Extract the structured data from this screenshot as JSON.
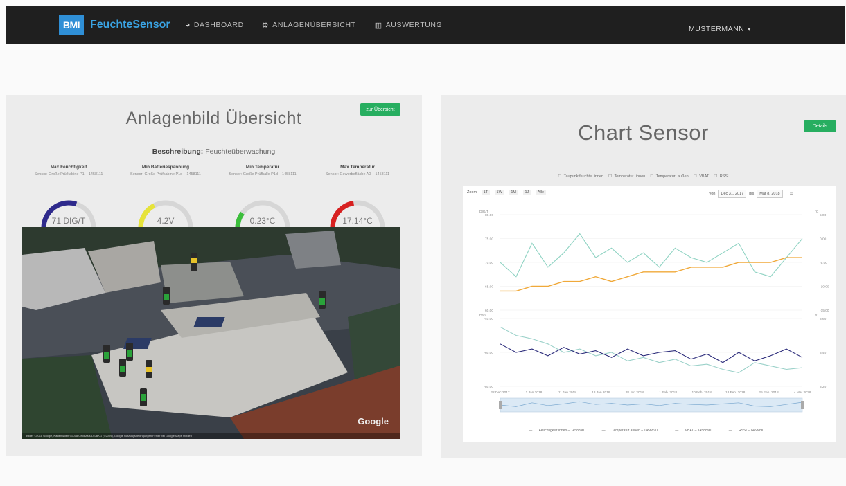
{
  "navbar": {
    "logo_text": "BMI",
    "brand": "FeuchteSensor",
    "links": [
      {
        "label": "DASHBOARD",
        "icon": "dashboard-icon"
      },
      {
        "label": "ANLAGENÜBERSICHT",
        "icon": "gear-icon"
      },
      {
        "label": "AUSWERTUNG",
        "icon": "chart-icon"
      }
    ],
    "user": "MUSTERMANN",
    "colors": {
      "bg": "#1f1f1f",
      "brand": "#3aa3e3",
      "logo_bg": "#2f8fd6"
    }
  },
  "left_panel": {
    "title": "Anlagenbild Übersicht",
    "button": "zur Übersicht",
    "description_label": "Beschreibung:",
    "description_value": "Feuchteüberwachung",
    "gauges": [
      {
        "title": "Max Feuchtigkeit",
        "sub": "Sensor: Große Prüfkabine P1 – 1458111",
        "value": "71 DIG/T",
        "fraction": 0.6,
        "color": "#2e2a8c"
      },
      {
        "title": "Min Batteriespannung",
        "sub": "Sensor: Große Prüfkabine P1d – 1458111",
        "value": "4.2V",
        "fraction": 0.35,
        "color": "#e6e33a"
      },
      {
        "title": "Min Temperatur",
        "sub": "Sensor: Große Prüfhalle P1d – 1458111",
        "value": "0.23°C",
        "fraction": 0.2,
        "color": "#3cbe3c"
      },
      {
        "title": "Max Temperatur",
        "sub": "Sensor: Gewerbefläche A0 – 1458111",
        "value": "17.14°C",
        "fraction": 0.45,
        "color": "#d72020"
      }
    ],
    "photo_credit": "Google",
    "photo_footer": "Bilder ©2018 Google, Kartendaten ©2018 GeoBasis-DE/BKG (©2009), Google   Nutzungsbedingungen   Fehler bei Google Maps melden"
  },
  "right_panel": {
    "title": "Chart Sensor",
    "button": "Details",
    "series_toggles": [
      "Taupunktfeuchte innen",
      "Temperatur innen",
      "Temperatur außen",
      "VBAT",
      "RSSI"
    ],
    "zoom_label": "Zoom",
    "zoom_options": [
      "1T",
      "1W",
      "1M",
      "1J",
      "Alle"
    ],
    "date_from_label": "Von",
    "date_from": "Dec 31, 2017",
    "date_to_label": "bis",
    "date_to": "Mar 8, 2018",
    "x_labels": [
      "22.Dec 2017",
      "1.Jan 2018",
      "11.Jan 2018",
      "18.Jan 2018",
      "28.Jan 2018",
      "1.Feb. 2018",
      "10.Feb. 2018",
      "18.Feb. 2018",
      "25.Feb. 2018",
      "4.Mar 2018"
    ],
    "upper_left_ticks": [
      "80.00",
      "75.00",
      "70.00",
      "65.00",
      "60.00"
    ],
    "upper_right_ticks": [
      "5.00",
      "0.00",
      "-5.00",
      "-10.00",
      "-15.00"
    ],
    "upper_left_unit": "DIG/T",
    "upper_right_unit": "°C",
    "lower_left_ticks": [
      "-40.00",
      "-60.00",
      "-80.00"
    ],
    "lower_right_ticks": [
      "3.60",
      "3.40",
      "3.20"
    ],
    "lower_left_unit": "Dbm",
    "lower_right_unit": "V",
    "bottom_legend": [
      "Feuchtigkeit innen – 1458890",
      "Temperatur außen – 1458890",
      "VBAT – 1458890",
      "RSSI – 1458890"
    ],
    "series_colors": {
      "humidity": "#8fd3c3",
      "temp": "#f0a93a",
      "vbat": "#9ad1c9",
      "rssi": "#2a2a7a"
    }
  },
  "chart_data": [
    {
      "type": "line",
      "title": "",
      "xlabel": "",
      "ylabel": "DIG/T",
      "ylim": [
        60,
        80
      ],
      "series": [
        {
          "name": "Feuchtigkeit innen – 1458890",
          "values": [
            70,
            67,
            74,
            69,
            72,
            76,
            71,
            73,
            70,
            72,
            69,
            73,
            71,
            70,
            72,
            74,
            68,
            67,
            71,
            75
          ]
        },
        {
          "name": "Temperatur außen – 1458890",
          "values": [
            64,
            64,
            65,
            65,
            66,
            66,
            67,
            66,
            67,
            68,
            68,
            68,
            69,
            69,
            69,
            70,
            70,
            70,
            71,
            71
          ]
        }
      ]
    },
    {
      "type": "line",
      "title": "",
      "xlabel": "",
      "ylabel": "Dbm",
      "ylim": [
        -80,
        -40
      ],
      "series": [
        {
          "name": "VBAT – 1458890",
          "values": [
            -45,
            -50,
            -52,
            -55,
            -60,
            -58,
            -62,
            -60,
            -65,
            -63,
            -66,
            -64,
            -68,
            -67,
            -70,
            -72,
            -66,
            -68,
            -70,
            -69
          ]
        },
        {
          "name": "RSSI – 1458890",
          "values": [
            -55,
            -60,
            -58,
            -62,
            -57,
            -61,
            -59,
            -63,
            -58,
            -62,
            -60,
            -59,
            -64,
            -61,
            -66,
            -60,
            -65,
            -62,
            -58,
            -63
          ]
        }
      ]
    }
  ]
}
